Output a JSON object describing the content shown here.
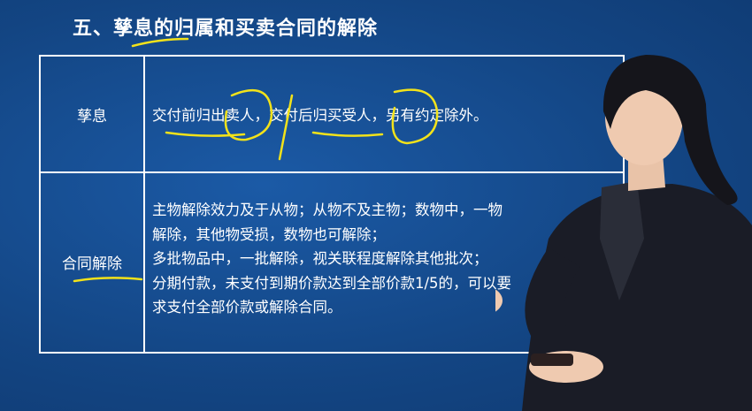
{
  "slide": {
    "title": "五、孳息的归属和买卖合同的解除",
    "rows": [
      {
        "label": "孳息",
        "text": "交付前归出卖人，交付后归买受人，另有约定除外。"
      },
      {
        "label": "合同解除",
        "lines": [
          "主物解除效力及于从物；从物不及主物；数物中，一物",
          "解除，其他物受损，数物也可解除；",
          "多批物品中，一批解除，视关联程度解除其他批次；",
          "分期付款，未支付到期价款达到全部价款1/5的，可以要",
          "求支付全部价款或解除合同。"
        ]
      }
    ]
  },
  "colors": {
    "background": "#14468a",
    "text": "#ffffff",
    "highlighter": "#f2e21a"
  }
}
